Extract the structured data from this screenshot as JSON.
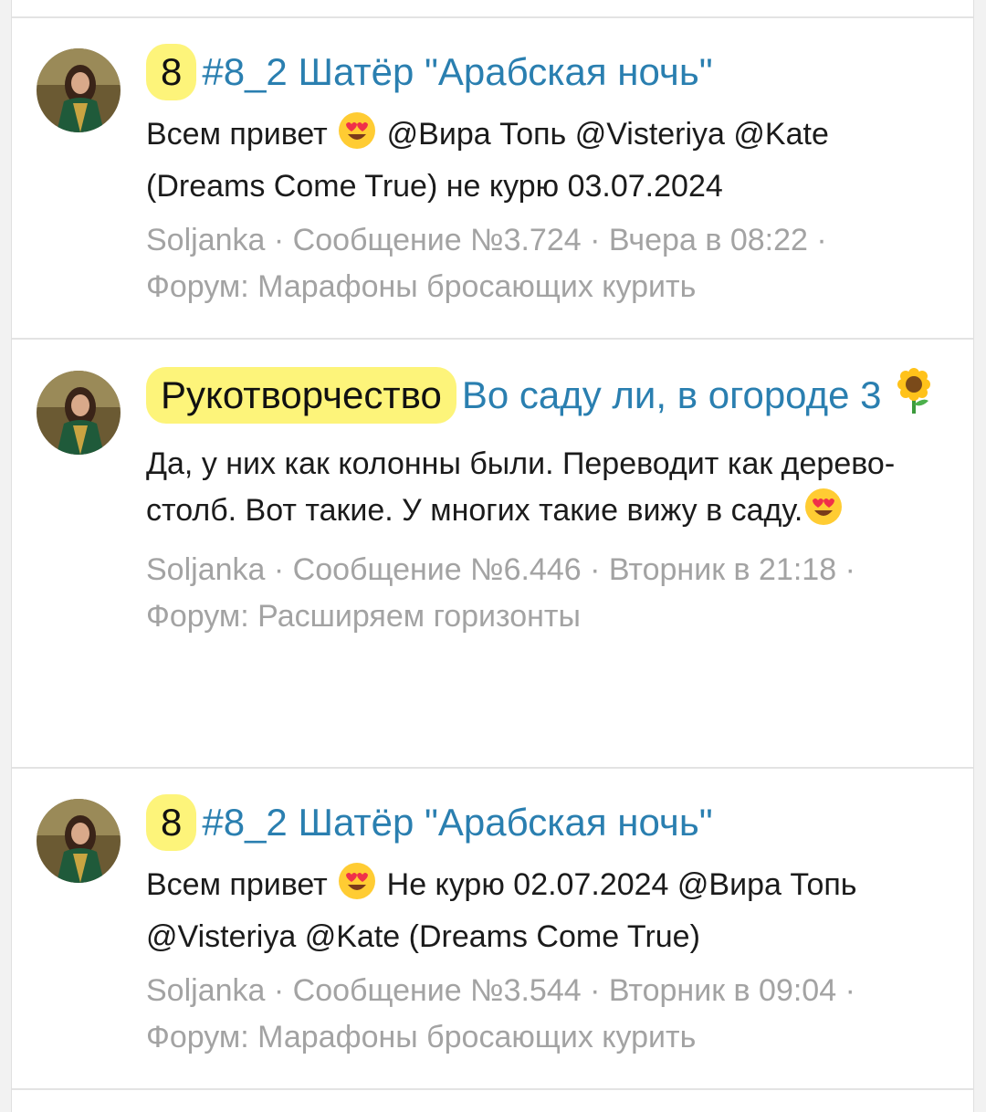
{
  "posts": [
    {
      "badge": "8",
      "title": "#8_2 Шатёр \"Арабская ночь\"",
      "body_before": "Всем привет ",
      "body_emoji": "heart-eyes",
      "body_after": " @Вира Топь @Visteriya @Kate (Dreams Come True) не курю 03.07.2024",
      "meta_line1": "Soljanka · Сообщение №3.724 · Вчера в 08:22 ·",
      "meta_line2": "Форум: Марафоны бросающих курить"
    },
    {
      "badge": "Рукотворчество",
      "title": "Во саду ли, в огороде 3",
      "title_emoji": "sunflower",
      "body_before": "Да, у них как колонны были. Переводит как дерево- столб. Вот такие. У многих такие вижу в саду.",
      "body_emoji": "heart-eyes",
      "body_after": "",
      "meta_line1": "Soljanka · Сообщение №6.446 · Вторник в 21:18 ·",
      "meta_line2": "Форум: Расширяем горизонты"
    },
    {
      "badge": "8",
      "title": "#8_2 Шатёр \"Арабская ночь\"",
      "body_before": "Всем привет ",
      "body_emoji": "heart-eyes",
      "body_after": " Не курю 02.07.2024 @Вира Топь @Visteriya @Kate (Dreams Come True)",
      "meta_line1": "Soljanka · Сообщение №3.544 · Вторник в 09:04 ·",
      "meta_line2": "Форум: Марафоны бросающих курить"
    }
  ],
  "colors": {
    "link": "#2a7fb0",
    "badge_bg": "#fdf47a",
    "meta": "#a3a3a3",
    "text": "#1b1b1b"
  }
}
